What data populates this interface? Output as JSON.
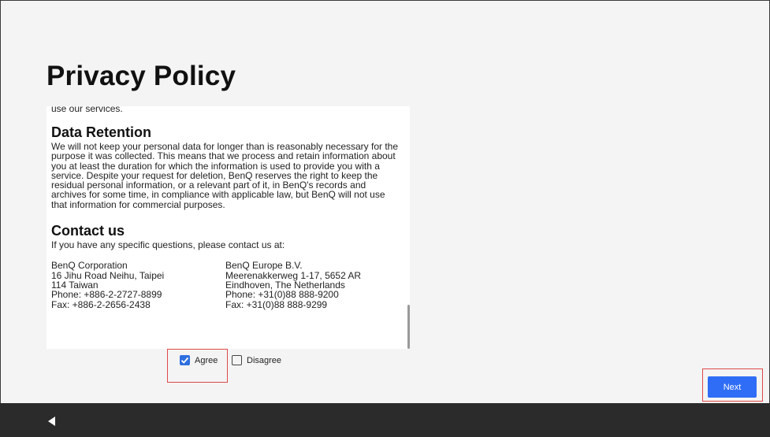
{
  "page": {
    "title": "Privacy Policy"
  },
  "policy": {
    "cut_text": "use our services.",
    "sections": [
      {
        "heading": "Data Retention",
        "body": "We will not keep your personal data for longer than is reasonably necessary for the purpose it was collected. This means that we process and retain information about you at least the duration for which the information is used to provide you with a service. Despite your request for deletion, BenQ reserves the right to keep the residual personal information, or a relevant part of it, in BenQ's records and archives for some time, in compliance with applicable law, but BenQ will not use that information for commercial purposes."
      },
      {
        "heading": "Contact us",
        "body": "If you have any specific questions, please contact us at:"
      }
    ],
    "contacts": [
      "BenQ Corporation\n16 Jihu Road Neihu, Taipei\n114 Taiwan\nPhone: +886-2-2727-8899\nFax: +886-2-2656-2438",
      "BenQ Europe B.V.\nMeerenakkerweg 1-17, 5652 AR\nEindhoven, The Netherlands\nPhone: +31(0)88 888-9200\nFax: +31(0)88 888-9299"
    ]
  },
  "consent": {
    "agree_label": "Agree",
    "disagree_label": "Disagree",
    "agree_checked": true
  },
  "actions": {
    "next_label": "Next"
  },
  "colors": {
    "accent": "#2f6df6",
    "highlight": "#e04848",
    "nav_bar": "#2b2b2b"
  },
  "icons": {
    "back": "back-triangle-icon",
    "check": "checkmark-icon"
  }
}
